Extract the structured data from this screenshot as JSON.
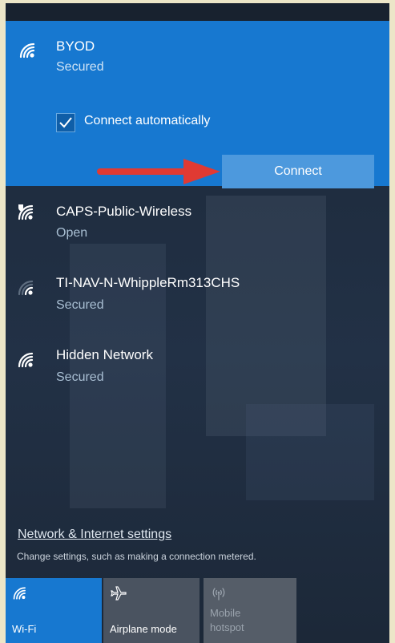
{
  "networks": [
    {
      "ssid": "BYOD",
      "status": "Secured",
      "icon": "wifi-signal-icon"
    },
    {
      "ssid": "CAPS-Public-Wireless",
      "status": "Open",
      "icon": "wifi-shield-icon"
    },
    {
      "ssid": "TI-NAV-N-WhippleRm313CHS",
      "status": "Secured",
      "icon": "wifi-weak-icon"
    },
    {
      "ssid": "Hidden Network",
      "status": "Secured",
      "icon": "wifi-signal-icon"
    }
  ],
  "selected": {
    "connect_automatically_label": "Connect automatically",
    "connect_automatically_checked": true,
    "connect_button": "Connect"
  },
  "footer": {
    "settings_link": "Network & Internet settings",
    "settings_desc": "Change settings, such as making a connection metered."
  },
  "quick_actions": [
    {
      "label": "Wi-Fi",
      "icon": "wifi-icon",
      "active": true
    },
    {
      "label": "Airplane mode",
      "icon": "airplane-icon",
      "active": false
    },
    {
      "label": "Mobile hotspot",
      "icon": "hotspot-icon",
      "active": false,
      "disabled": true
    }
  ],
  "colors": {
    "accent": "#1778d0",
    "annotation_arrow": "#e03a33"
  }
}
